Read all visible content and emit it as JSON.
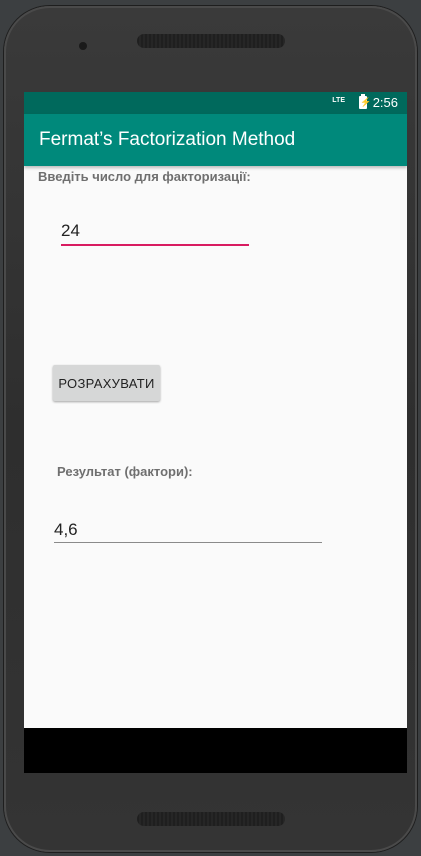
{
  "status_bar": {
    "network": "LTE",
    "time": "2:56"
  },
  "app_bar": {
    "title": "Fermat’s Factorization Method"
  },
  "form": {
    "input_label": "Введіть число для факторизації:",
    "input_value": "24",
    "calculate_button_label": "РОЗРАХУВАТИ",
    "result_label": "Результат (фактори):",
    "result_value": "4,6"
  },
  "colors": {
    "status_bar": "#00695c",
    "app_bar": "#00897b",
    "input_underline": "#d81b60",
    "screen_background": "#fafafa"
  }
}
